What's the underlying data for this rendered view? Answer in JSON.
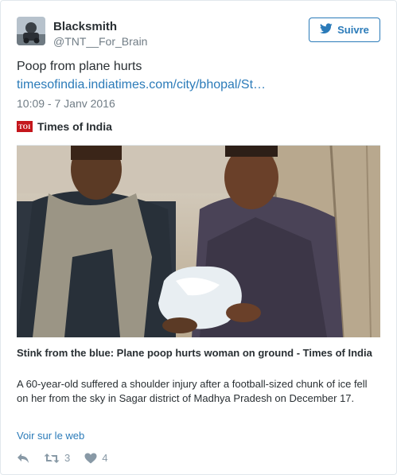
{
  "user": {
    "name": "Blacksmith",
    "handle": "@TNT__For_Brain"
  },
  "follow_button": {
    "label": "Suivre",
    "icon": "twitter-bird-icon"
  },
  "tweet": {
    "text": "Poop from plane hurts",
    "link": "timesofindia.indiatimes.com/city/bhopal/St…",
    "timestamp": "10:09 - 7 Janv 2016"
  },
  "card": {
    "source_logo_text": "TOI",
    "source_name": "Times of India",
    "title": "Stink from the blue: Plane poop hurts woman on ground - Times of India",
    "description": "A 60-year-old suffered a shoulder injury after a football-sized chunk of ice fell on her from the sky in Sagar district of Madhya Pradesh on December 17."
  },
  "view_on_web": "Voir sur le web",
  "actions": {
    "reply_icon": "reply-icon",
    "retweet_icon": "retweet-icon",
    "retweet_count": "3",
    "like_icon": "heart-icon",
    "like_count": "4"
  },
  "colors": {
    "link": "#2b7bb9",
    "muted": "#707c85",
    "text": "#292f33",
    "toi_red": "#c4161c"
  }
}
